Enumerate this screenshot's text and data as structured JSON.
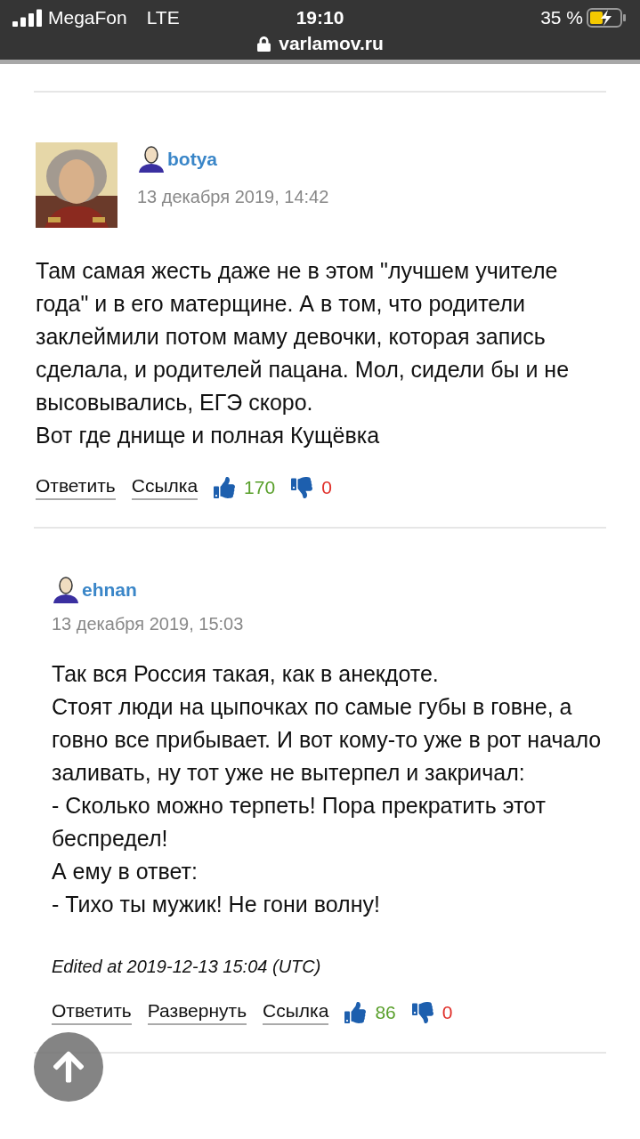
{
  "status_bar": {
    "carrier": "MegaFon",
    "network": "LTE",
    "time": "19:10",
    "battery": "35 %",
    "charging": true,
    "url": "varlamov.ru"
  },
  "comments": [
    {
      "author": "botya",
      "avatar": {
        "kind": "picture"
      },
      "date": "13 декабря 2019, 14:42",
      "paragraphs": [
        "Там самая жесть даже не в этом \"лучшем учителе года\" и в его матерщине. А в том, что родители заклеймили потом маму девочки, которая запись сделала, и родителей пацана. Мол, сидели бы и не высовывались, ЕГЭ скоро.",
        "Вот где днище и полная Кущёвка"
      ],
      "links": [
        "Ответить",
        "Ссылка"
      ],
      "likes": "170",
      "dislikes": "0",
      "children": [
        {
          "author": "ehnan",
          "date": "13 декабря 2019, 15:03",
          "paragraphs": [
            "Так вся Россия такая, как в анекдоте.",
            "Стоят люди на цыпочках по самые губы в говне, а говно все прибывает. И вот кому-то уже в рот начало заливать, ну тот уже не вытерпел и закричал:",
            "- Сколько можно терпеть! Пора прекратить этот беспредел!",
            "А ему в ответ:",
            "- Тихо ты мужик! Не гони волну!"
          ],
          "edited": "Edited at 2019-12-13 15:04 (UTC)",
          "links": [
            "Ответить",
            "Развернуть",
            "Ссылка"
          ],
          "likes": "86",
          "dislikes": "0"
        }
      ]
    }
  ]
}
